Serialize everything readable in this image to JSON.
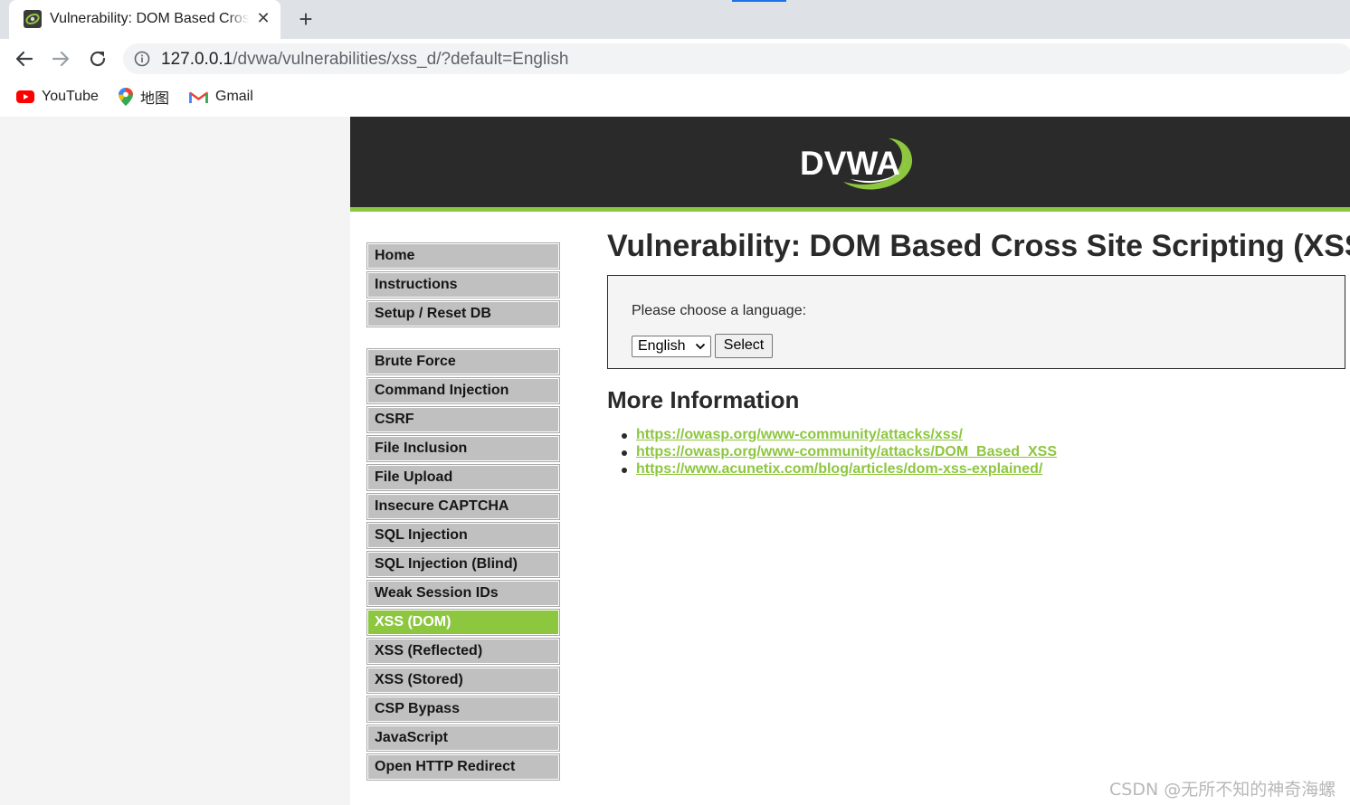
{
  "browser": {
    "tab_title": "Vulnerability: DOM Based Cross Site Scripting (XSS)",
    "new_tab": "+",
    "close": "✕",
    "url_host": "127.0.0.1",
    "url_path": "/dvwa/vulnerabilities/xss_d/?default=English",
    "bookmarks": [
      "YouTube",
      "地图",
      "Gmail"
    ]
  },
  "header": {
    "logo_text": "DVWA"
  },
  "menu": {
    "items": [
      "Home",
      "Instructions",
      "Setup / Reset DB",
      "Brute Force",
      "Command Injection",
      "CSRF",
      "File Inclusion",
      "File Upload",
      "Insecure CAPTCHA",
      "SQL Injection",
      "SQL Injection (Blind)",
      "Weak Session IDs",
      "XSS (DOM)",
      "XSS (Reflected)",
      "XSS (Stored)",
      "CSP Bypass",
      "JavaScript",
      "Open HTTP Redirect"
    ],
    "selected": "XSS (DOM)"
  },
  "main": {
    "title": "Vulnerability: DOM Based Cross Site Scripting (XSS)",
    "prompt": "Please choose a language:",
    "select_value": "English",
    "submit_label": "Select",
    "more_title": "More Information",
    "links": [
      "https://owasp.org/www-community/attacks/xss/",
      "https://owasp.org/www-community/attacks/DOM_Based_XSS",
      "https://www.acunetix.com/blog/articles/dom-xss-explained/"
    ]
  },
  "watermark": "CSDN @无所不知的神奇海螺",
  "colors": {
    "accent": "#8dc63f",
    "header_bg": "#2a2a2a",
    "menu_bg": "#c0c0c0",
    "chrome_bg": "#dee1e6"
  }
}
